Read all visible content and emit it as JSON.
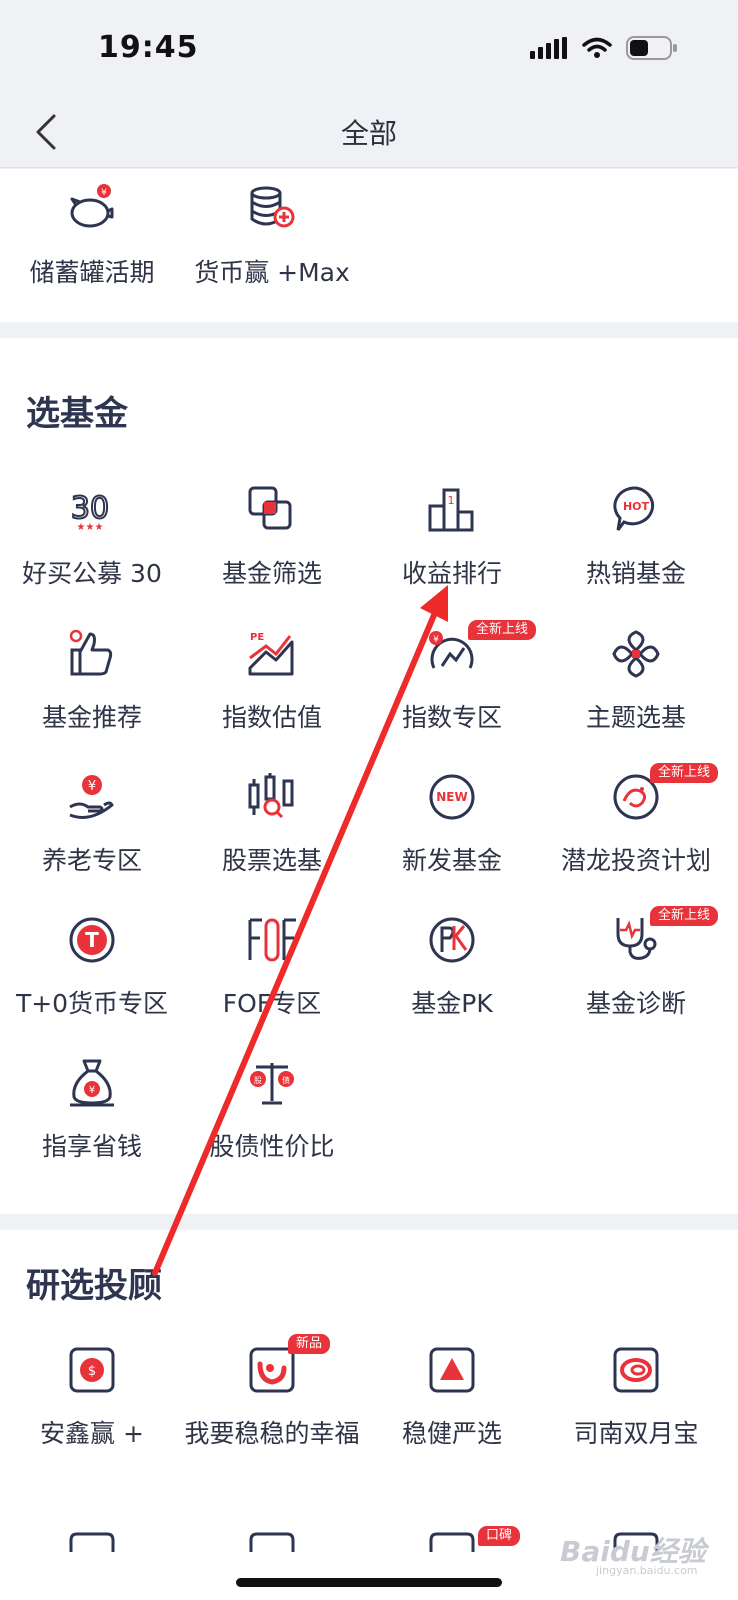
{
  "status": {
    "time": "19:45"
  },
  "nav": {
    "title": "全部"
  },
  "top_items": [
    {
      "label": "储蓄罐活期",
      "icon": "piggy-bank-icon"
    },
    {
      "label": "货币赢 +Max",
      "icon": "coins-plus-icon"
    }
  ],
  "fund_section": {
    "title": "选基金",
    "items": [
      {
        "label": "好买公募 30",
        "icon": "top-30-icon"
      },
      {
        "label": "基金筛选",
        "icon": "filter-squares-icon"
      },
      {
        "label": "收益排行",
        "icon": "ranking-podium-icon"
      },
      {
        "label": "热销基金",
        "icon": "hot-bubble-icon"
      },
      {
        "label": "基金推荐",
        "icon": "thumbs-up-icon"
      },
      {
        "label": "指数估值",
        "icon": "pe-chart-icon"
      },
      {
        "label": "指数专区",
        "icon": "index-gauge-icon",
        "badge": "全新上线"
      },
      {
        "label": "主题选基",
        "icon": "theme-flower-icon"
      },
      {
        "label": "养老专区",
        "icon": "pension-hand-icon"
      },
      {
        "label": "股票选基",
        "icon": "candlestick-search-icon"
      },
      {
        "label": "新发基金",
        "icon": "new-badge-icon"
      },
      {
        "label": "潜龙投资计划",
        "icon": "dragon-icon",
        "badge": "全新上线"
      },
      {
        "label": "T+0货币专区",
        "icon": "t-plus-zero-icon"
      },
      {
        "label": "FOF专区",
        "icon": "fof-icon"
      },
      {
        "label": "基金PK",
        "icon": "pk-icon"
      },
      {
        "label": "基金诊断",
        "icon": "stethoscope-icon",
        "badge": "全新上线"
      },
      {
        "label": "指享省钱",
        "icon": "money-bag-icon"
      },
      {
        "label": "股债性价比",
        "icon": "balance-scale-icon"
      }
    ]
  },
  "advisor_section": {
    "title": "研选投顾",
    "items": [
      {
        "label": "安鑫赢 +",
        "icon": "dollar-square-icon"
      },
      {
        "label": "我要稳稳的幸福",
        "icon": "smile-square-icon",
        "badge": "新品"
      },
      {
        "label": "稳健严选",
        "icon": "triangle-square-icon"
      },
      {
        "label": "司南双月宝",
        "icon": "spiral-square-icon"
      }
    ],
    "partial_badge": "口碑"
  },
  "watermark": {
    "text": "Baidu经验",
    "sub": "jingyan.baidu.com"
  },
  "colors": {
    "accent": "#e8333a",
    "icon": "#2e3550",
    "background": "#f0f1f5"
  }
}
